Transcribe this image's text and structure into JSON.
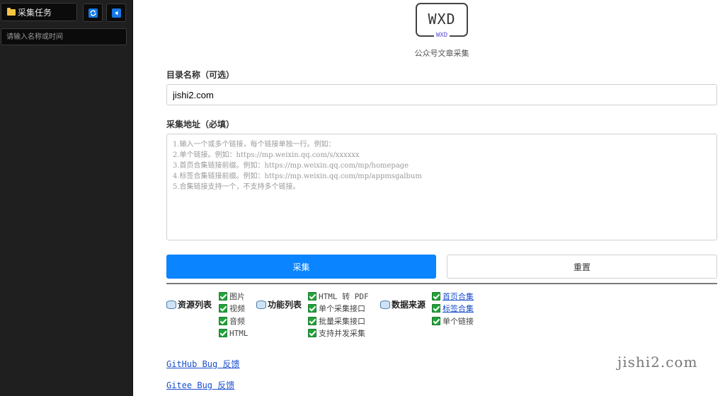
{
  "sidebar": {
    "task_label": "采集任务",
    "search_placeholder": "请输入名称或时间"
  },
  "logo": {
    "main": "WXD",
    "sub": "WXD",
    "caption": "公众号文章采集"
  },
  "form": {
    "dir_label": "目录名称（可选）",
    "dir_value": "jishi2.com",
    "url_label": "采集地址（必填）",
    "url_placeholder": "1.输入一个或多个链接，每个链接单独一行。例如：\n2.单个链接。例如：https://mp.weixin.qq.com/s/xxxxxx\n3.首页合集链接前缀。例如：https://mp.weixin.qq.com/mp/homepage\n4.标签合集链接前缀。例如：https://mp.weixin.qq.com/mp/appmsgalbum\n5.合集链接支持一个，不支持多个链接。",
    "collect_label": "采集",
    "reset_label": "重置"
  },
  "groups": {
    "resources": {
      "title": "资源列表",
      "items": [
        "图片",
        "视频",
        "音频",
        "HTML"
      ]
    },
    "features": {
      "title": "功能列表",
      "items": [
        "HTML 转 PDF",
        "单个采集接口",
        "批量采集接口",
        "支持并发采集"
      ]
    },
    "sources": {
      "title": "数据来源",
      "items": [
        "首页合集",
        "标签合集",
        "单个链接"
      ]
    }
  },
  "footer": {
    "github": "GitHub Bug 反馈",
    "gitee": "Gitee Bug 反馈"
  },
  "watermark": "jishi2.com",
  "colors": {
    "accent": "#0a84ff",
    "sidebar_bg": "#1f1f1f",
    "check": "#22a33a"
  }
}
